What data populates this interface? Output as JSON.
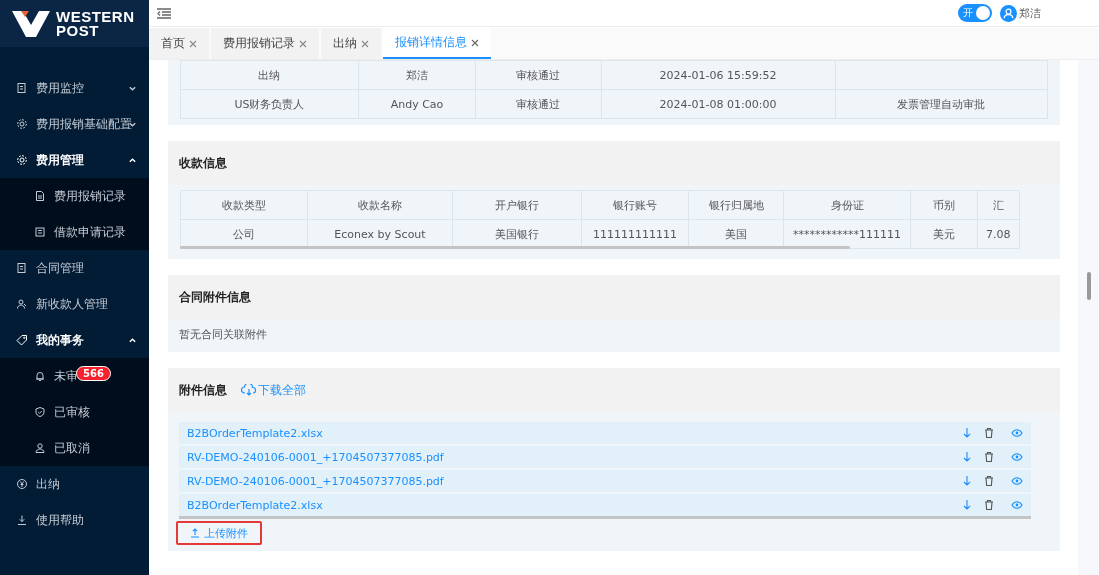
{
  "logo": {
    "line1": "WESTERN",
    "line2": "POST"
  },
  "sidebar": {
    "items": [
      {
        "label": "费用监控",
        "expanded": false
      },
      {
        "label": "费用报销基础配置",
        "expanded": false
      },
      {
        "label": "费用管理",
        "expanded": true,
        "children": [
          {
            "label": "费用报销记录"
          },
          {
            "label": "借款申请记录"
          }
        ]
      },
      {
        "label": "合同管理"
      },
      {
        "label": "新收款人管理"
      },
      {
        "label": "我的事务",
        "expanded": true,
        "children": [
          {
            "label": "未审",
            "badge": "566"
          },
          {
            "label": "已审核"
          },
          {
            "label": "已取消"
          }
        ]
      },
      {
        "label": "出纳"
      },
      {
        "label": "使用帮助"
      }
    ]
  },
  "header": {
    "toggle": {
      "label": "开",
      "on": true
    },
    "user": "郑洁"
  },
  "tabs": [
    {
      "label": "首页",
      "selected": false
    },
    {
      "label": "费用报销记录",
      "selected": false
    },
    {
      "label": "出纳",
      "selected": false
    },
    {
      "label": "报销详情信息",
      "selected": true
    }
  ],
  "approvals": {
    "rows": [
      [
        "出纳",
        "郑洁",
        "审核通过",
        "2024-01-06 15:59:52",
        ""
      ],
      [
        "US财务负责人",
        "Andy Cao",
        "审核通过",
        "2024-01-08 01:00:00",
        "发票管理自动审批"
      ]
    ]
  },
  "payment": {
    "title": "收款信息",
    "columns": [
      "收款类型",
      "收款名称",
      "开户银行",
      "银行账号",
      "银行归属地",
      "身份证",
      "币别",
      "汇"
    ],
    "rows": [
      [
        "公司",
        "Econex by Scout",
        "美国银行",
        "111111111111",
        "美国",
        "************111111",
        "美元",
        "7.08"
      ]
    ]
  },
  "contract": {
    "title": "合同附件信息",
    "empty": "暂无合同关联附件"
  },
  "attachments": {
    "title": "附件信息",
    "download_all": "下载全部",
    "files": [
      "B2BOrderTemplate2.xlsx",
      "RV-DEMO-240106-0001_+1704507377085.pdf",
      "RV-DEMO-240106-0001_+1704507377085.pdf",
      "B2BOrderTemplate2.xlsx"
    ],
    "upload": "上传附件"
  }
}
